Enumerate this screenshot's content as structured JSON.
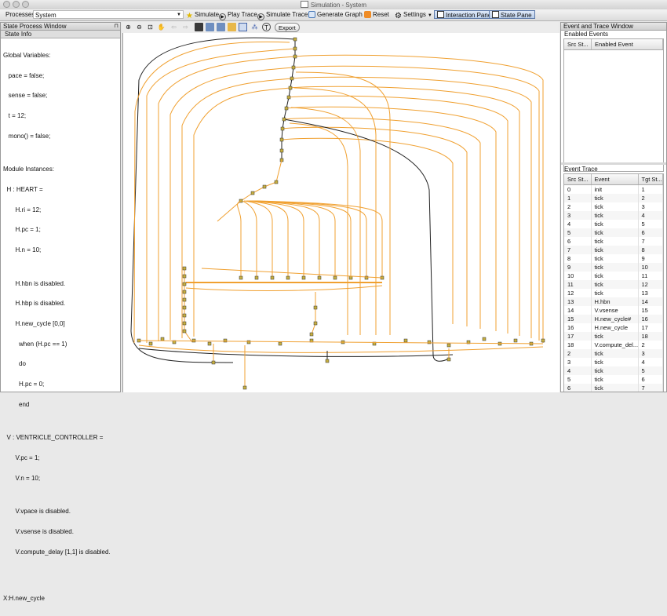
{
  "window": {
    "title": "Simulation - System"
  },
  "menu": {
    "processes_label": "Processes",
    "system_label": "System"
  },
  "toolbar": {
    "simulate": "Simulate",
    "play_trace": "Play Trace",
    "simulate_trace": "Simulate Trace",
    "generate_graph": "Generate Graph",
    "reset": "Reset",
    "settings": "Settings",
    "interaction_pane": "Interaction Pane",
    "state_pane": "State Pane"
  },
  "state_window": {
    "title": "State Process Window",
    "tab": "State Info",
    "lines": [
      "Global Variables:",
      "   pace = false;",
      "   sense = false;",
      "   t = 12;",
      "   mono() = false;",
      "",
      "Module Instances:",
      "  H : HEART =",
      "       H.ri = 12;",
      "       H.pc = 1;",
      "       H.n = 10;",
      "",
      "       H.hbn is disabled.",
      "       H.hbp is disabled.",
      "       H.new_cycle [0,0]",
      "         when (H.pc == 1)",
      "         do",
      "         H.pc = 0;",
      "         end",
      "",
      "  V : VENTRICLE_CONTROLLER =",
      "       V.pc = 1;",
      "       V.n = 10;",
      "",
      "       V.vpace is disabled.",
      "       V.vsense is disabled.",
      "       V.compute_delay [1,1] is disabled.",
      "",
      "",
      "X:H.new_cycle"
    ]
  },
  "graph_tools": {
    "export": "Export",
    "text_tool": "T"
  },
  "event_window": {
    "title": "Event and Trace Window",
    "enabled_events_label": "Enabled Events",
    "enabled_columns": [
      "Src St...",
      "Enabled Event"
    ],
    "trace_label": "Event Trace",
    "trace_columns": [
      "Src St...",
      "Event",
      "Tgt St..."
    ],
    "trace_rows": [
      [
        "0",
        "init",
        "1"
      ],
      [
        "1",
        "tick",
        "2"
      ],
      [
        "2",
        "tick",
        "3"
      ],
      [
        "3",
        "tick",
        "4"
      ],
      [
        "4",
        "tick",
        "5"
      ],
      [
        "5",
        "tick",
        "6"
      ],
      [
        "6",
        "tick",
        "7"
      ],
      [
        "7",
        "tick",
        "8"
      ],
      [
        "8",
        "tick",
        "9"
      ],
      [
        "9",
        "tick",
        "10"
      ],
      [
        "10",
        "tick",
        "11"
      ],
      [
        "11",
        "tick",
        "12"
      ],
      [
        "12",
        "tick",
        "13"
      ],
      [
        "13",
        "H.hbn",
        "14"
      ],
      [
        "14",
        "V.vsense",
        "15"
      ],
      [
        "15",
        "H.new_cycle#",
        "16"
      ],
      [
        "16",
        "H.new_cycle",
        "17"
      ],
      [
        "17",
        "tick",
        "18"
      ],
      [
        "18",
        "V.compute_del...",
        "2"
      ],
      [
        "2",
        "tick",
        "3"
      ],
      [
        "3",
        "tick",
        "4"
      ],
      [
        "4",
        "tick",
        "5"
      ],
      [
        "5",
        "tick",
        "6"
      ],
      [
        "6",
        "tick",
        "7"
      ]
    ]
  },
  "colors": {
    "edge": "#f0a030",
    "active_edge": "#222222",
    "node": "#c8b040",
    "toggle": "#b9cde9"
  }
}
